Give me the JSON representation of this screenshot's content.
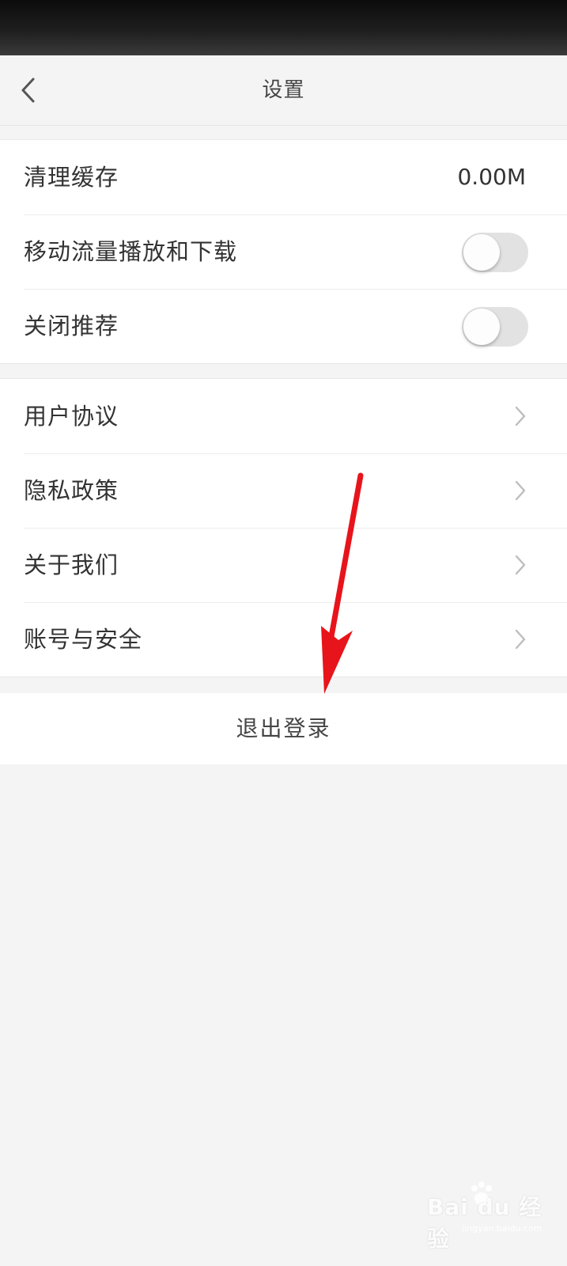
{
  "header": {
    "title": "设置"
  },
  "settings_group": {
    "clear_cache": {
      "label": "清理缓存",
      "value": "0.00M"
    },
    "mobile_data": {
      "label": "移动流量播放和下载",
      "enabled": false
    },
    "close_recommend": {
      "label": "关闭推荐",
      "enabled": false
    }
  },
  "info_group": {
    "items": [
      {
        "label": "用户协议"
      },
      {
        "label": "隐私政策"
      },
      {
        "label": "关于我们"
      },
      {
        "label": "账号与安全"
      }
    ]
  },
  "logout": {
    "label": "退出登录"
  },
  "annotation": {
    "arrow_color": "#e8141b"
  },
  "watermark": {
    "main": "Bai du 经验",
    "sub": "jingyan.baidu.com"
  },
  "colors": {
    "background": "#f4f4f4",
    "card": "#ffffff",
    "text": "#333333",
    "toggle_off": "#e2e2e2"
  }
}
